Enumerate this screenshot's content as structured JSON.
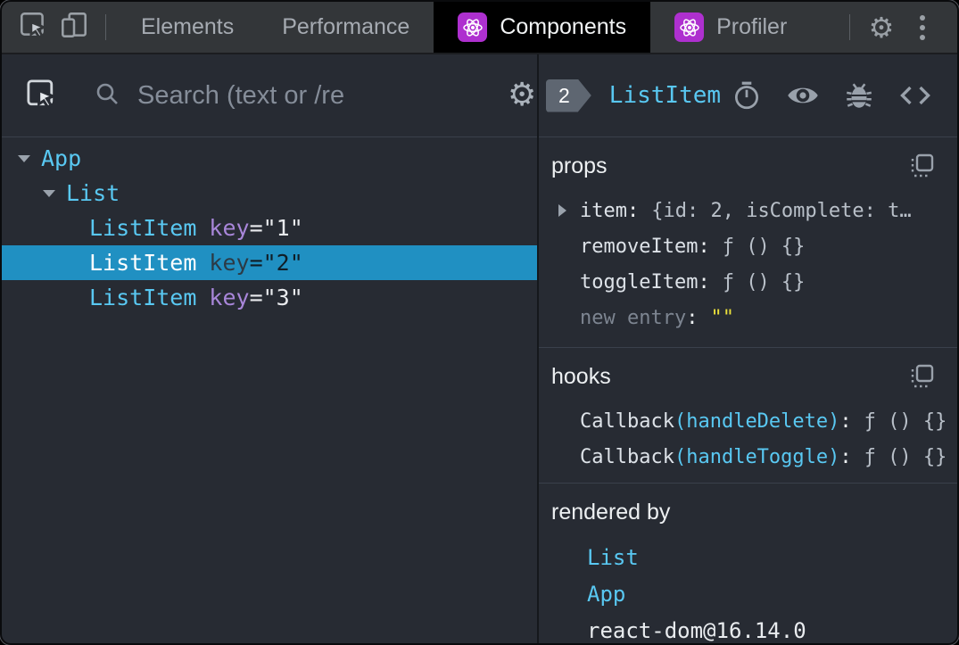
{
  "topbar": {
    "inspect_icon": "inspect-cursor",
    "device_icon": "device-toolbar",
    "tabs": [
      {
        "label": "Elements",
        "active": false,
        "icon": null
      },
      {
        "label": "Performance",
        "active": false,
        "icon": null
      },
      {
        "label": "Components",
        "active": true,
        "icon": "react-atom"
      },
      {
        "label": "Profiler",
        "active": false,
        "icon": "react-atom"
      }
    ],
    "gear_icon": "settings-gear",
    "menu_icon": "kebab-menu",
    "gear_glyph": "⚙"
  },
  "left_panel": {
    "toolbar": {
      "inspect_icon": "inspect-cursor",
      "search_icon": "magnifier",
      "search_placeholder": "Search (text or /re",
      "search_value": "",
      "settings_icon": "settings-gear",
      "gear_glyph": "⚙"
    },
    "tree": {
      "rows": [
        {
          "name": "App",
          "expanded": true,
          "indent": 0,
          "selected": false
        },
        {
          "name": "List",
          "expanded": true,
          "indent": 1,
          "selected": false
        },
        {
          "name": "ListItem",
          "indent": 2,
          "attr_name": "key",
          "attr_value": "=\"1\"",
          "selected": false
        },
        {
          "name": "ListItem",
          "indent": 2,
          "attr_name": "key",
          "attr_value": "=\"2\"",
          "selected": true
        },
        {
          "name": "ListItem",
          "indent": 2,
          "attr_name": "key",
          "attr_value": "=\"3\"",
          "selected": false
        }
      ]
    }
  },
  "right_panel": {
    "header": {
      "badge": "2",
      "title": "ListItem",
      "icons": [
        "stopwatch",
        "eye",
        "bug",
        "view-source"
      ]
    },
    "props": {
      "label": "props",
      "copy_icon": "copy",
      "rows": [
        {
          "name": "item",
          "value": "{id: 2, isComplete: t…",
          "expandable": true
        },
        {
          "name": "removeItem",
          "value": "ƒ () {}",
          "expandable": false
        },
        {
          "name": "toggleItem",
          "value": "ƒ () {}",
          "expandable": false
        },
        {
          "name": "new entry",
          "value": "\"\"",
          "editable": true
        }
      ]
    },
    "hooks": {
      "label": "hooks",
      "copy_icon": "copy",
      "rows": [
        {
          "type": "Callback",
          "hook": "(handleDelete)",
          "value": "ƒ () {}"
        },
        {
          "type": "Callback",
          "hook": "(handleToggle)",
          "value": "ƒ () {}"
        }
      ]
    },
    "rendered_by": {
      "label": "rendered by",
      "items": [
        "List",
        "App"
      ],
      "library": "react-dom@16.14.0"
    }
  },
  "colors": {
    "component_cyan": "#59c8f2",
    "attribute_purple": "#a886d9",
    "edit_yellow": "#ece13b",
    "selected_row_blue": "#2090c2",
    "react_icon_purple": "#ae30cf",
    "panel_background": "#272b33",
    "topbar_background": "#333639",
    "active_tab_background": "#000000"
  }
}
